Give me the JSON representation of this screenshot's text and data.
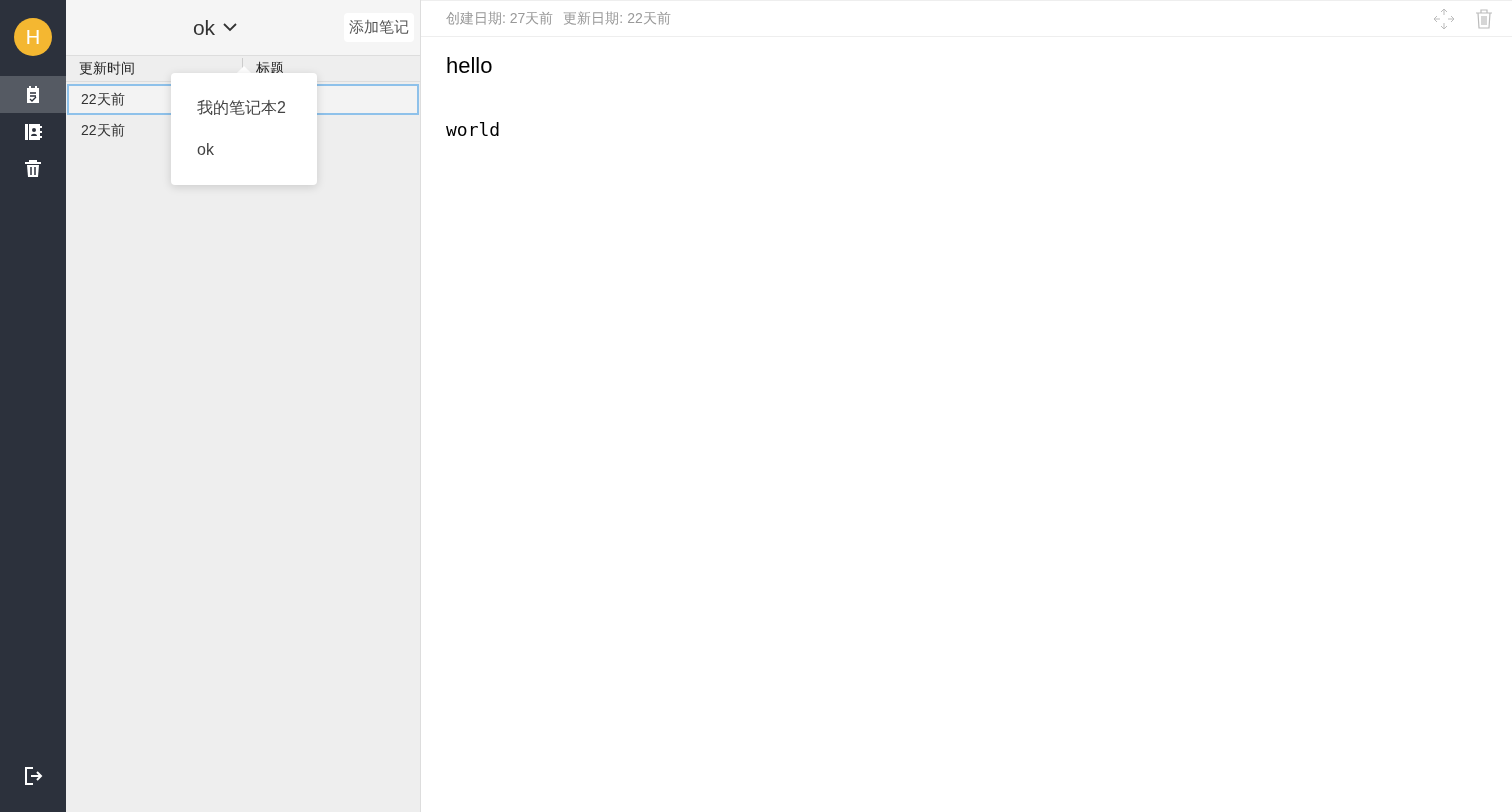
{
  "sidebar": {
    "avatar": "H",
    "items": [
      {
        "kind": "notes",
        "selected": true
      },
      {
        "kind": "notebooks",
        "selected": false
      },
      {
        "kind": "trash",
        "selected": false
      }
    ]
  },
  "note_list": {
    "notebook": "ok",
    "add_button": "添加笔记",
    "columns": [
      "更新时间",
      "标题"
    ],
    "rows": [
      {
        "updated": "22天前",
        "selected": true
      },
      {
        "updated": "22天前",
        "selected": false
      }
    ],
    "dropdown": {
      "items": [
        "我的笔记本2",
        "ok"
      ]
    }
  },
  "editor": {
    "created": "创建日期: 27天前",
    "updated": "更新日期: 22天前",
    "title": "hello",
    "body": "world"
  }
}
